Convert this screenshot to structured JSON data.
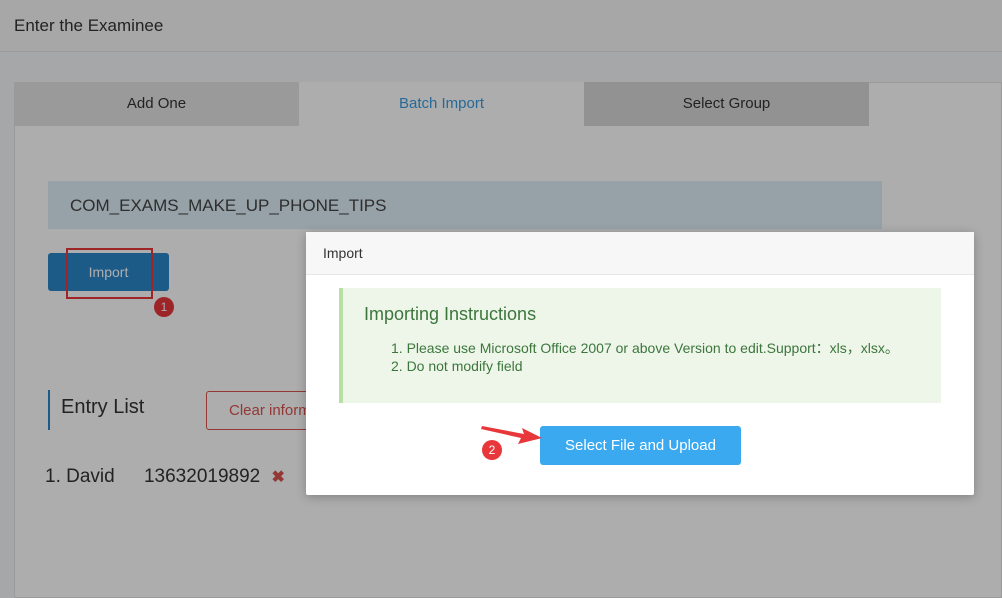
{
  "header": {
    "title": "Enter the Examinee"
  },
  "tabs": [
    {
      "label": "Add One"
    },
    {
      "label": "Batch Import"
    },
    {
      "label": "Select Group"
    }
  ],
  "tips": {
    "text": "COM_EXAMS_MAKE_UP_PHONE_TIPS"
  },
  "import_button": {
    "label": "Import"
  },
  "annotations": {
    "badge1": "1",
    "badge2": "2"
  },
  "entry_list": {
    "title": "Entry List",
    "clear_label": "Clear inform",
    "items": [
      {
        "name": "1. David",
        "phone": "13632019892",
        "delete": "✖"
      }
    ]
  },
  "modal": {
    "title": "Import",
    "instructions_title": "Importing Instructions",
    "instructions": [
      "1. Please use Microsoft Office 2007 or above Version to edit.Support：xls，xlsx。",
      "2. Do not modify field"
    ],
    "upload_label": "Select File and Upload"
  },
  "colors": {
    "accent": "#3aa9f0",
    "annotation_red": "#e8373a",
    "success_text": "#3c763d"
  }
}
